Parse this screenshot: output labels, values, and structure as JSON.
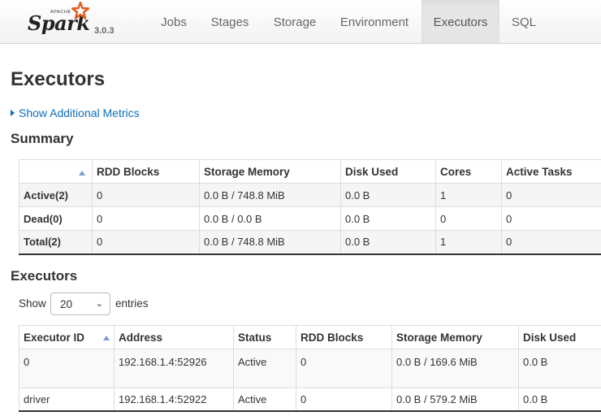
{
  "nav": {
    "logo_apache": "APACHE",
    "logo_spark": "Spark",
    "version": "3.0.3",
    "tabs": [
      {
        "label": "Jobs"
      },
      {
        "label": "Stages"
      },
      {
        "label": "Storage"
      },
      {
        "label": "Environment"
      },
      {
        "label": "Executors",
        "active": true
      },
      {
        "label": "SQL"
      }
    ]
  },
  "page": {
    "title": "Executors",
    "metrics_link": "Show Additional Metrics"
  },
  "summary": {
    "heading": "Summary",
    "columns": [
      "",
      "RDD Blocks",
      "Storage Memory",
      "Disk Used",
      "Cores",
      "Active Tasks"
    ],
    "rows": [
      [
        "Active(2)",
        "0",
        "0.0 B / 748.8 MiB",
        "0.0 B",
        "1",
        "0"
      ],
      [
        "Dead(0)",
        "0",
        "0.0 B / 0.0 B",
        "0.0 B",
        "0",
        "0"
      ],
      [
        "Total(2)",
        "0",
        "0.0 B / 748.8 MiB",
        "0.0 B",
        "1",
        "0"
      ]
    ]
  },
  "executors": {
    "heading": "Executors",
    "show_label": "Show",
    "entries_value": "20",
    "entries_label": "entries",
    "columns": [
      "Executor ID",
      "Address",
      "Status",
      "RDD Blocks",
      "Storage Memory",
      "Disk Used"
    ],
    "rows": [
      [
        "0",
        "192.168.1.4:52926",
        "Active",
        "0",
        "0.0 B / 169.6 MiB",
        "0.0 B"
      ],
      [
        "driver",
        "192.168.1.4:52922",
        "Active",
        "0",
        "0.0 B / 579.2 MiB",
        "0.0 B"
      ]
    ]
  },
  "colors": {
    "link": "#0c6fb8",
    "logo_star": "#e25a1c",
    "active_tab_bg": "#e6e6e6"
  }
}
